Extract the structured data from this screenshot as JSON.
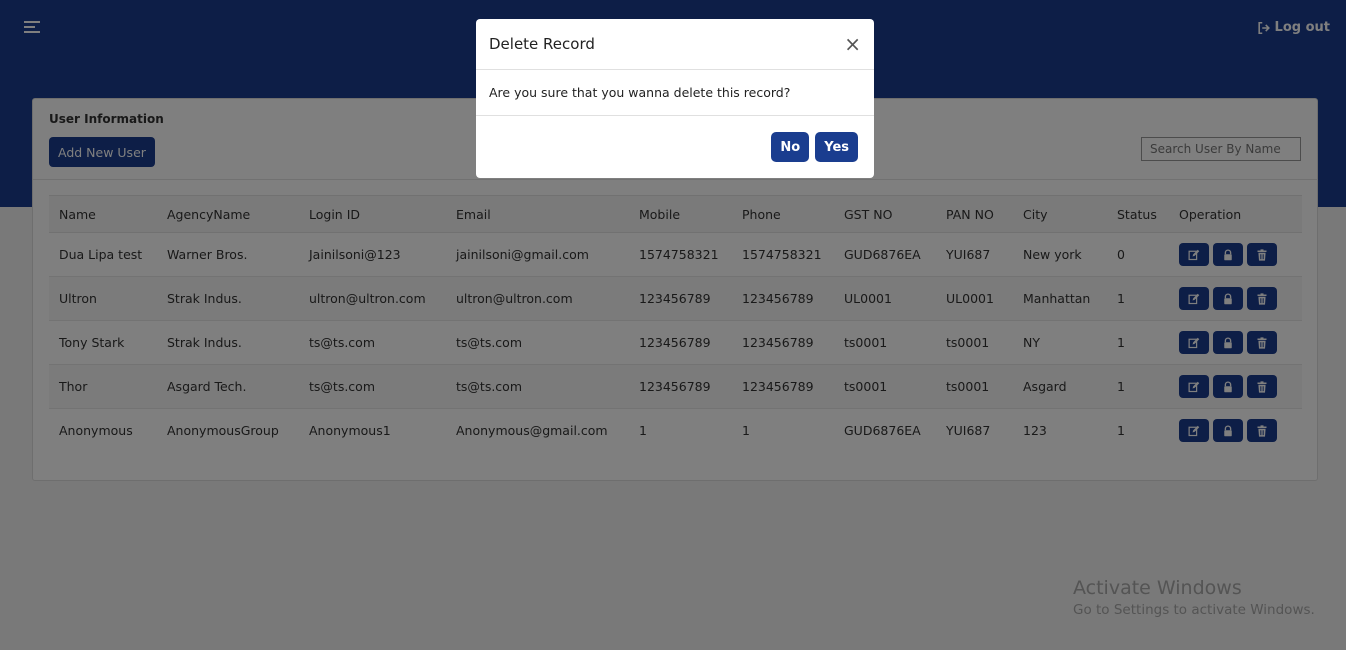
{
  "header": {
    "logout_label": "Log out"
  },
  "card": {
    "title": "User Information",
    "add_button": "Add New User",
    "search_placeholder": "Search User By Name"
  },
  "table": {
    "columns": [
      "Name",
      "AgencyName",
      "Login ID",
      "Email",
      "Mobile",
      "Phone",
      "GST NO",
      "PAN NO",
      "City",
      "Status",
      "Operation"
    ],
    "rows": [
      [
        "Dua Lipa test",
        "Warner Bros.",
        "Jainilsoni@123",
        "jainilsoni@gmail.com",
        "1574758321",
        "1574758321",
        "GUD6876EA",
        "YUI687",
        "New york",
        "0"
      ],
      [
        "Ultron",
        "Strak Indus.",
        "ultron@ultron.com",
        "ultron@ultron.com",
        "123456789",
        "123456789",
        "UL0001",
        "UL0001",
        "Manhattan",
        "1"
      ],
      [
        "Tony Stark",
        "Strak Indus.",
        "ts@ts.com",
        "ts@ts.com",
        "123456789",
        "123456789",
        "ts0001",
        "ts0001",
        "NY",
        "1"
      ],
      [
        "Thor",
        "Asgard Tech.",
        "ts@ts.com",
        "ts@ts.com",
        "123456789",
        "123456789",
        "ts0001",
        "ts0001",
        "Asgard",
        "1"
      ],
      [
        "Anonymous",
        "AnonymousGroup",
        "Anonymous1",
        "Anonymous@gmail.com",
        "1",
        "1",
        "GUD6876EA",
        "YUI687",
        "123",
        "1"
      ]
    ],
    "operation_icons": [
      "edit-icon",
      "lock-icon",
      "trash-icon"
    ]
  },
  "modal": {
    "title": "Delete Record",
    "close": "×",
    "message": "Are you sure that you wanna delete this record?",
    "no_label": "No",
    "yes_label": "Yes"
  },
  "watermark": {
    "line1": "Activate Windows",
    "line2": "Go to Settings to activate Windows."
  },
  "colors": {
    "primary": "#1a3d8f"
  }
}
